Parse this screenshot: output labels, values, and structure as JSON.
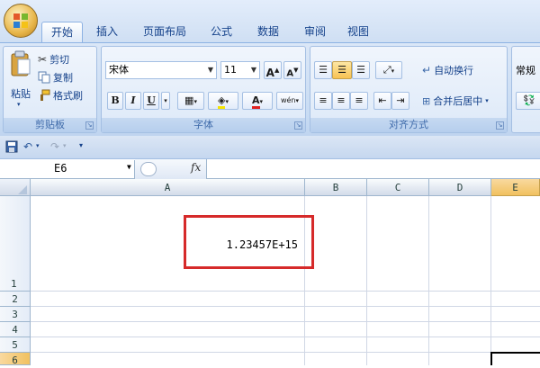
{
  "tabs": [
    {
      "label": "开始",
      "active": true
    },
    {
      "label": "插入",
      "active": false
    },
    {
      "label": "页面布局",
      "active": false
    },
    {
      "label": "公式",
      "active": false
    },
    {
      "label": "数据",
      "active": false
    },
    {
      "label": "审阅",
      "active": false
    },
    {
      "label": "视图",
      "active": false
    }
  ],
  "clipboard": {
    "paste_label": "粘贴",
    "cut_label": "剪切",
    "copy_label": "复制",
    "format_painter_label": "格式刷",
    "group_label": "剪贴板"
  },
  "font": {
    "font_name": "宋体",
    "font_size": "11",
    "grow_label": "A",
    "shrink_label": "A",
    "bold_label": "B",
    "italic_label": "I",
    "underline_label": "U",
    "font_color_label": "A",
    "phonetic_label": "wén",
    "group_label": "字体"
  },
  "alignment": {
    "wrap_text_label": "自动换行",
    "merge_center_label": "合并后居中",
    "group_label": "对齐方式"
  },
  "number": {
    "format_value": "常规"
  },
  "formula_bar": {
    "name_box_value": "E6",
    "fx_label": "fx",
    "formula_value": ""
  },
  "grid": {
    "columns": [
      "A",
      "B",
      "C",
      "D",
      "E"
    ],
    "selected_column": "E",
    "rows": [
      "1",
      "2",
      "3",
      "4",
      "5",
      "6"
    ],
    "cell_A1_value": "1.23457E+15"
  },
  "colors": {
    "highlight_box": "#d62a2a",
    "selected_header": "#f1c15f"
  }
}
